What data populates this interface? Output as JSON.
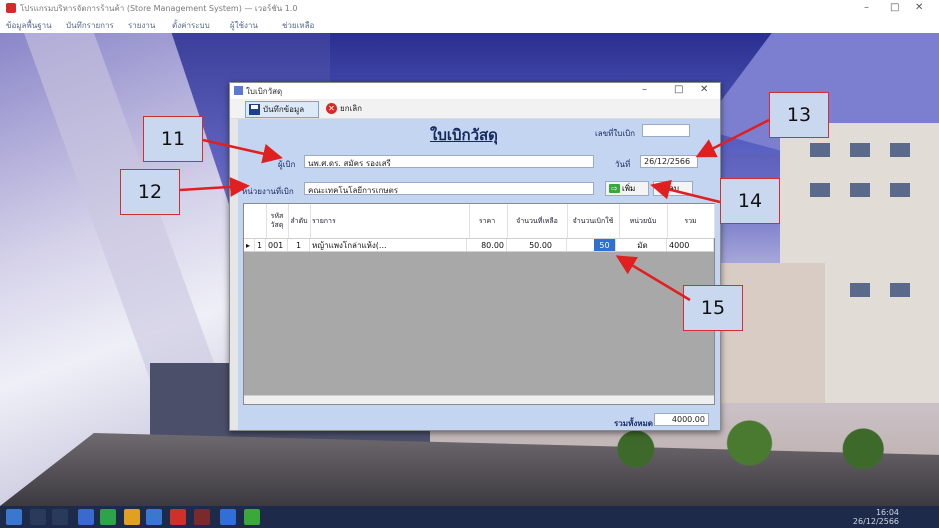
{
  "app": {
    "title": "โปรแกรมบริหารจัดการร้านค้า (Store Management System) — เวอร์ชัน 1.0",
    "menu": [
      "ข้อมูลพื้นฐาน",
      "บันทึกรายการ",
      "รายงาน",
      "ตั้งค่าระบบ",
      "ผู้ใช้งาน",
      "ช่วยเหลือ"
    ],
    "window_controls": [
      "–",
      "□",
      "✕"
    ]
  },
  "dialog": {
    "title": "ใบเบิกวัสดุ",
    "window_controls": [
      "–",
      "□",
      "✕"
    ],
    "toolbar": {
      "save_label": "บันทึกข้อมูล",
      "cancel_label": "ยกเลิก"
    },
    "form_title": "ใบเบิกวัสดุ",
    "doc_no_label": "เลขที่ใบเบิก",
    "doc_no_value": "",
    "requester_label": "ผู้เบิก",
    "requester_value": "นพ.ศ.ดร. สมัคร รองเสรี",
    "department_label": "หน่วยงานที่เบิก",
    "department_value": "คณะเทคโนโลยีการเกษตร",
    "date_label": "วันที่",
    "date_value": "26/12/2566",
    "add_label": "เพิ่ม",
    "delete_label": "ลบ",
    "grid": {
      "columns": [
        "รหัสวัสดุ",
        "ลำดับ",
        "รายการ",
        "ราคา",
        "จำนวนที่เหลือ",
        "จำนวนเบิกใช้",
        "หน่วยนับ",
        "รวม"
      ],
      "rows": [
        {
          "marker": "▸",
          "no": "1",
          "code": "001",
          "seq": "1",
          "item": "หญ้าแพงโกล่าแห้ง(...",
          "price": "80.00",
          "remain": "50.00",
          "qty": "50",
          "unit": "มัด",
          "total": "4000"
        }
      ]
    },
    "total_label": "รวมทั้งหมด",
    "total_value": "4000.00"
  },
  "callouts": [
    "11",
    "12",
    "13",
    "14",
    "15"
  ],
  "taskbar": {
    "time": "16:04",
    "date": "26/12/2566"
  }
}
